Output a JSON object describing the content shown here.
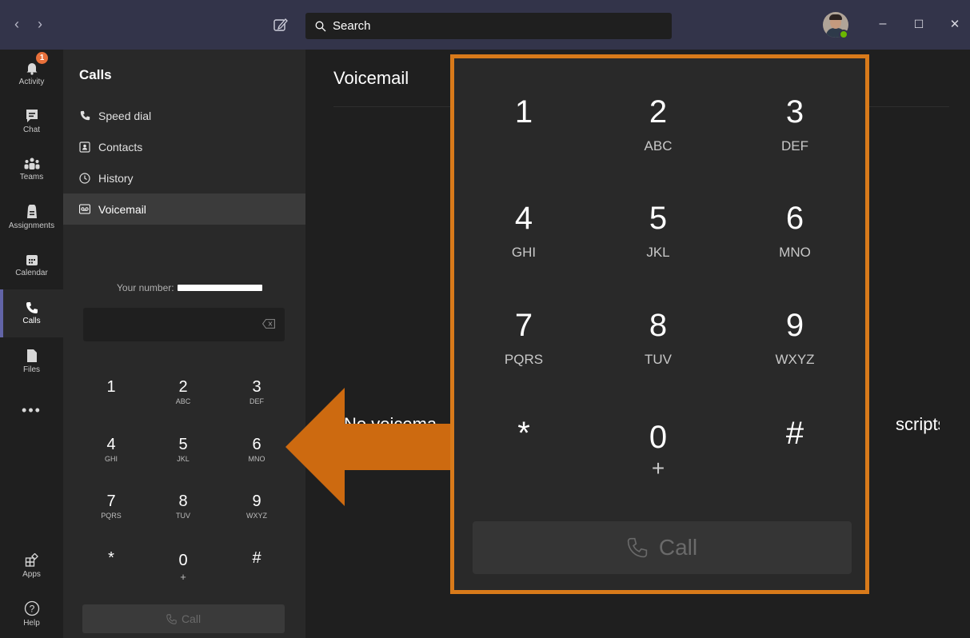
{
  "titlebar": {
    "back_icon": "chevron-left-icon",
    "forward_icon": "chevron-right-icon",
    "compose_icon": "new-chat-icon",
    "search_label": "Search",
    "minimize": "–",
    "maximize": "☐",
    "close": "✕"
  },
  "appbar": {
    "items": [
      {
        "label": "Activity",
        "icon": "bell-icon",
        "badge": "1"
      },
      {
        "label": "Chat",
        "icon": "chat-icon"
      },
      {
        "label": "Teams",
        "icon": "teams-icon"
      },
      {
        "label": "Assignments",
        "icon": "assignments-icon"
      },
      {
        "label": "Calendar",
        "icon": "calendar-icon"
      },
      {
        "label": "Calls",
        "icon": "phone-icon",
        "active": true
      },
      {
        "label": "Files",
        "icon": "file-icon"
      },
      {
        "label": "Apps",
        "icon": "apps-icon"
      },
      {
        "label": "Help",
        "icon": "help-icon"
      }
    ],
    "more": "•••"
  },
  "calls": {
    "title": "Calls",
    "nav": [
      {
        "label": "Speed dial",
        "icon": "phone-icon"
      },
      {
        "label": "Contacts",
        "icon": "contacts-icon"
      },
      {
        "label": "History",
        "icon": "clock-icon"
      },
      {
        "label": "Voicemail",
        "icon": "voicemail-icon",
        "active": true
      }
    ],
    "your_number_label": "Your number:",
    "call_label": "Call"
  },
  "dialpad": {
    "keys": [
      {
        "digit": "1",
        "letters": ""
      },
      {
        "digit": "2",
        "letters": "ABC"
      },
      {
        "digit": "3",
        "letters": "DEF"
      },
      {
        "digit": "4",
        "letters": "GHI"
      },
      {
        "digit": "5",
        "letters": "JKL"
      },
      {
        "digit": "6",
        "letters": "MNO"
      },
      {
        "digit": "7",
        "letters": "PQRS"
      },
      {
        "digit": "8",
        "letters": "TUV"
      },
      {
        "digit": "9",
        "letters": "WXYZ"
      },
      {
        "digit": "*",
        "letters": ""
      },
      {
        "digit": "0",
        "letters": "+"
      },
      {
        "digit": "#",
        "letters": ""
      }
    ]
  },
  "main": {
    "title": "Voicemail",
    "empty_left": "No voicema",
    "empty_right": "scripts,"
  },
  "zoom": {
    "call_label": "Call"
  },
  "colors": {
    "titlebar": "#33344a",
    "accent": "#6264a7",
    "highlight": "#d87a1a",
    "presence": "#6bb700"
  }
}
